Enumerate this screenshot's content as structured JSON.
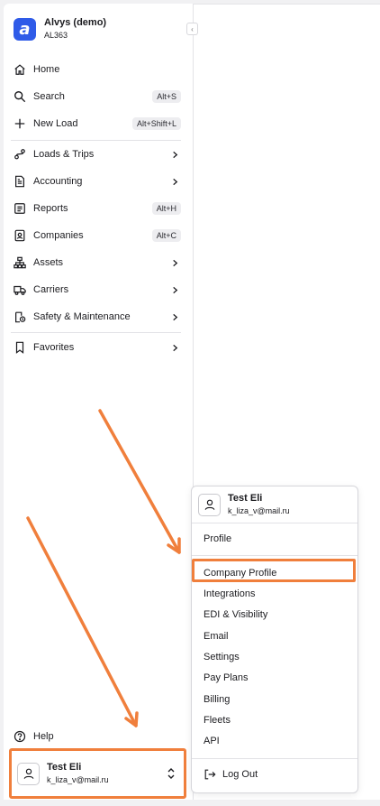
{
  "org": {
    "logo_letter": "a",
    "name": "Alvys (demo)",
    "code": "AL363",
    "logo_color": "#2f5be8"
  },
  "collapse_glyph": "‹",
  "nav": {
    "home": {
      "label": "Home",
      "icon": "home-icon"
    },
    "search": {
      "label": "Search",
      "shortcut": "Alt+S",
      "icon": "search-icon"
    },
    "new_load": {
      "label": "New Load",
      "shortcut": "Alt+Shift+L",
      "icon": "plus-icon"
    },
    "loads_trips": {
      "label": "Loads & Trips",
      "icon": "route-icon"
    },
    "accounting": {
      "label": "Accounting",
      "icon": "accounting-icon"
    },
    "reports": {
      "label": "Reports",
      "shortcut": "Alt+H",
      "icon": "reports-icon"
    },
    "companies": {
      "label": "Companies",
      "shortcut": "Alt+C",
      "icon": "companies-icon"
    },
    "assets": {
      "label": "Assets",
      "icon": "hierarchy-icon"
    },
    "carriers": {
      "label": "Carriers",
      "icon": "truck-icon"
    },
    "safety": {
      "label": "Safety & Maintenance",
      "icon": "safety-icon"
    },
    "favorites": {
      "label": "Favorites",
      "icon": "bookmark-icon"
    },
    "help": {
      "label": "Help",
      "icon": "help-icon"
    }
  },
  "user": {
    "name": "Test Eli",
    "email": "k_liza_v@mail.ru"
  },
  "menu": {
    "profile": "Profile",
    "company_profile": "Company Profile",
    "integrations": "Integrations",
    "edi_visibility": "EDI & Visibility",
    "email": "Email",
    "settings": "Settings",
    "pay_plans": "Pay Plans",
    "billing": "Billing",
    "fleets": "Fleets",
    "api": "API",
    "log_out": "Log Out"
  },
  "colors": {
    "highlight": "#f07f3c",
    "shortcut_bg": "#ededf0",
    "background": "#f1f1f3"
  }
}
